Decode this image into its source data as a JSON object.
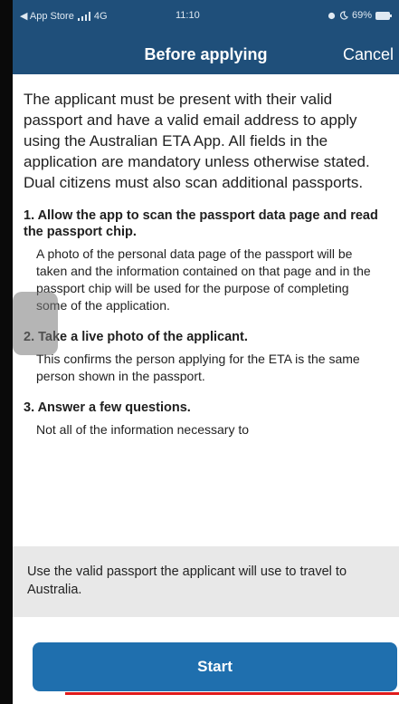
{
  "status_bar": {
    "left_text": "◀ App Store",
    "network": "4G",
    "time": "11:10",
    "battery": "69%"
  },
  "nav": {
    "title": "Before applying",
    "cancel_label": "Cancel"
  },
  "content": {
    "intro": "The applicant must be present with their valid passport and have a valid email address to apply using the Australian ETA App. All fields in the application are mandatory unless otherwise stated. Dual citizens must also scan additional passports.",
    "steps": [
      {
        "title": "1. Allow the app to scan the passport data page and read the passport chip.",
        "body": "A photo of the personal data page of the passport will be taken and the information contained on that page and in the passport chip will be used for the purpose of completing some of the application."
      },
      {
        "title": "2. Take a live photo of the applicant.",
        "body": "This confirms the person applying for the ETA is the same person shown in the passport."
      },
      {
        "title": "3. Answer a few questions.",
        "body": "Not all of the information necessary to"
      }
    ]
  },
  "notice": {
    "text": "Use the valid passport the applicant will use to travel to Australia."
  },
  "actions": {
    "start_label": "Start"
  },
  "colors": {
    "header_bg": "#1f4f7a",
    "button_bg": "#1f6fae",
    "notice_bg": "#e8e8e8",
    "underline": "#e01b1b"
  }
}
